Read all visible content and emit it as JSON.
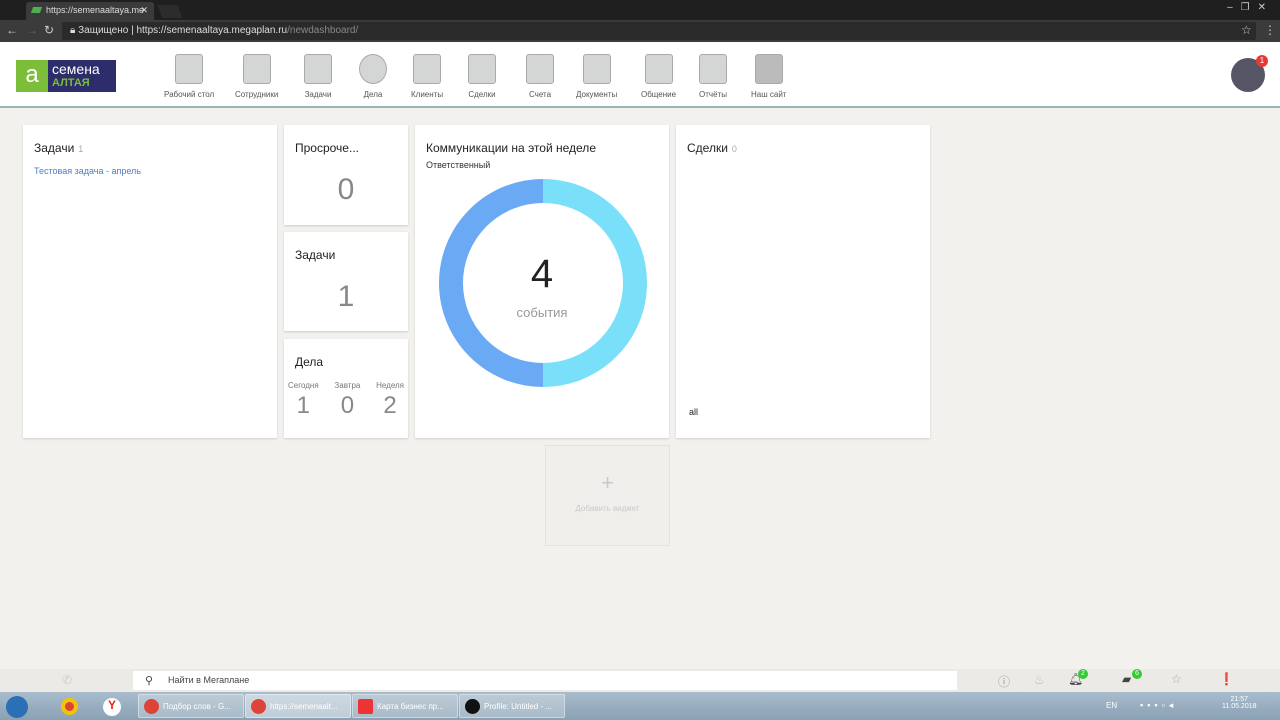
{
  "browser": {
    "tab_title": "https://semenaaltaya.me",
    "secure_label": "Защищено",
    "url_host": "https://semenaaltaya.megaplan.ru",
    "url_path": "/newdashboard/"
  },
  "logo": {
    "line1": "семена",
    "line2": "АЛТАЯ"
  },
  "nav": [
    {
      "label": "Рабочий стол"
    },
    {
      "label": "Сотрудники"
    },
    {
      "label": "Задачи"
    },
    {
      "label": "Дела"
    },
    {
      "label": "Клиенты"
    },
    {
      "label": "Сделки"
    },
    {
      "label": "Счета"
    },
    {
      "label": "Документы"
    },
    {
      "label": "Общение"
    },
    {
      "label": "Отчёты"
    },
    {
      "label": "Наш сайт"
    }
  ],
  "avatar_badge": "1",
  "widgets": {
    "tasks": {
      "title": "Задачи",
      "count": "1",
      "item": "Тестовая задача - апрель"
    },
    "overdue": {
      "title": "Просроче...",
      "value": "0"
    },
    "tasks_small": {
      "title": "Задачи",
      "value": "1"
    },
    "affairs": {
      "title": "Дела",
      "cols": [
        {
          "label": "Сегодня",
          "value": "1"
        },
        {
          "label": "Завтра",
          "value": "0"
        },
        {
          "label": "Неделя",
          "value": "2"
        }
      ]
    },
    "comms": {
      "title": "Коммуникации на этой неделе",
      "subtitle": "Ответственный",
      "total": "4",
      "unit": "события",
      "colors": [
        "#6aa9f4",
        "#7ae0fa"
      ],
      "shares": [
        0.5,
        0.5
      ]
    },
    "deals": {
      "title": "Сделки",
      "count": "0",
      "footer": "all"
    },
    "add": {
      "plus": "+",
      "label": "Добавить виджет"
    }
  },
  "bottom": {
    "search_placeholder": "Найти в Мегаплане",
    "notif_count": "2",
    "msg_count": "6"
  },
  "taskbar": {
    "items": [
      "Подбор слов - G...",
      "https://semenaalt...",
      "Карта бизнес пр...",
      "Profile: Untitled - ..."
    ],
    "lang": "EN",
    "time": "21:57",
    "date": "11.05.2018"
  }
}
